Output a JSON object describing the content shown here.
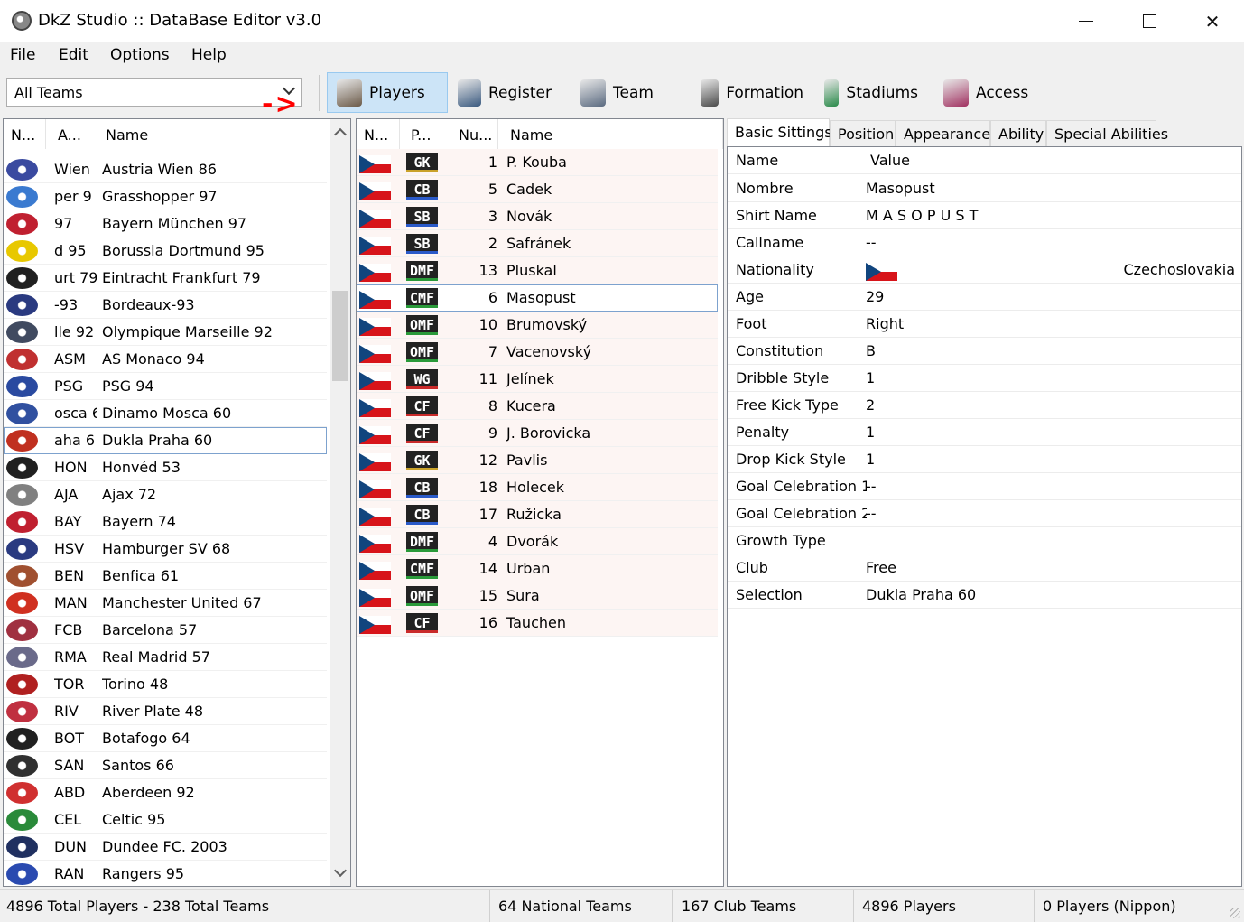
{
  "window": {
    "title": "DkZ Studio :: DataBase Editor v3.0"
  },
  "menu": [
    "File",
    "Edit",
    "Options",
    "Help"
  ],
  "toolbar": {
    "team_filter": "All Teams",
    "buttons": [
      {
        "label": "Players",
        "icon": "player-head-icon",
        "active": true
      },
      {
        "label": "Register",
        "icon": "register-players-icon",
        "active": false
      },
      {
        "label": "Team",
        "icon": "team-badge-icon",
        "active": false
      },
      {
        "label": "Formation",
        "icon": "formation-10-icon",
        "active": false
      },
      {
        "label": "Stadiums",
        "icon": "stadium-icon",
        "active": false
      },
      {
        "label": "Access",
        "icon": "access-database-icon",
        "active": false
      }
    ]
  },
  "teams_list": {
    "headers": [
      "N...",
      "A...",
      "Name"
    ],
    "selected_index": 10,
    "rows": [
      {
        "abbr": "Wien",
        "name": "Austria Wien 86",
        "color": "#3a4aa0"
      },
      {
        "abbr": "per 9",
        "name": "Grasshopper 97",
        "color": "#3a7ad0"
      },
      {
        "abbr": "97",
        "name": "Bayern München 97",
        "color": "#c02030"
      },
      {
        "abbr": "d 95",
        "name": "Borussia Dortmund 95",
        "color": "#e8c800"
      },
      {
        "abbr": "urt 79",
        "name": "Eintracht Frankfurt 79",
        "color": "#202020"
      },
      {
        "abbr": "-93",
        "name": "Bordeaux-93",
        "color": "#2a3a80"
      },
      {
        "abbr": "lle 92",
        "name": "Olympique Marseille 92",
        "color": "#404a60"
      },
      {
        "abbr": "ASM",
        "name": "AS Monaco 94",
        "color": "#c03030"
      },
      {
        "abbr": "PSG",
        "name": "PSG 94",
        "color": "#2a4aa0"
      },
      {
        "abbr": "osca 6",
        "name": "Dinamo Mosca 60",
        "color": "#3050a0"
      },
      {
        "abbr": "aha 6",
        "name": "Dukla Praha 60",
        "color": "#c03020"
      },
      {
        "abbr": "HON",
        "name": "Honvéd 53",
        "color": "#202020"
      },
      {
        "abbr": "AJA",
        "name": "Ajax 72",
        "color": "#808080"
      },
      {
        "abbr": "BAY",
        "name": "Bayern 74",
        "color": "#c02030"
      },
      {
        "abbr": "HSV",
        "name": "Hamburger SV 68",
        "color": "#2a3a80"
      },
      {
        "abbr": "BEN",
        "name": "Benfica 61",
        "color": "#a05030"
      },
      {
        "abbr": "MAN",
        "name": "Manchester United 67",
        "color": "#d03020"
      },
      {
        "abbr": "FCB",
        "name": "Barcelona 57",
        "color": "#a03040"
      },
      {
        "abbr": "RMA",
        "name": "Real Madrid 57",
        "color": "#6a6a8a"
      },
      {
        "abbr": "TOR",
        "name": "Torino 48",
        "color": "#b02020"
      },
      {
        "abbr": "RIV",
        "name": "River Plate 48",
        "color": "#c03040"
      },
      {
        "abbr": "BOT",
        "name": "Botafogo 64",
        "color": "#202020"
      },
      {
        "abbr": "SAN",
        "name": "Santos 66",
        "color": "#303030"
      },
      {
        "abbr": "ABD",
        "name": "Aberdeen 92",
        "color": "#d03030"
      },
      {
        "abbr": "CEL",
        "name": "Celtic 95",
        "color": "#2a8a3a"
      },
      {
        "abbr": "DUN",
        "name": "Dundee FC. 2003",
        "color": "#203060"
      },
      {
        "abbr": "RAN",
        "name": "Rangers 95",
        "color": "#2a4ab0"
      }
    ]
  },
  "arrow_annotation": "->",
  "players_list": {
    "headers": [
      "N...",
      "P...",
      "Nu...",
      "Name"
    ],
    "selected_index": 5,
    "rows": [
      {
        "pos": "GK",
        "num": "1",
        "name": "P. Kouba",
        "kind": "gk"
      },
      {
        "pos": "CB",
        "num": "5",
        "name": "Cadek",
        "kind": "df"
      },
      {
        "pos": "SB",
        "num": "3",
        "name": "Novák",
        "kind": "df"
      },
      {
        "pos": "SB",
        "num": "2",
        "name": "Safránek",
        "kind": "df"
      },
      {
        "pos": "DMF",
        "num": "13",
        "name": "Pluskal",
        "kind": "md"
      },
      {
        "pos": "CMF",
        "num": "6",
        "name": "Masopust",
        "kind": "md"
      },
      {
        "pos": "OMF",
        "num": "10",
        "name": "Brumovský",
        "kind": "md"
      },
      {
        "pos": "OMF",
        "num": "7",
        "name": "Vacenovský",
        "kind": "md"
      },
      {
        "pos": "WG",
        "num": "11",
        "name": "Jelínek",
        "kind": "fw"
      },
      {
        "pos": "CF",
        "num": "8",
        "name": "Kucera",
        "kind": "fw"
      },
      {
        "pos": "CF",
        "num": "9",
        "name": "J. Borovicka",
        "kind": "fw"
      },
      {
        "pos": "GK",
        "num": "12",
        "name": "Pavlis",
        "kind": "gk"
      },
      {
        "pos": "CB",
        "num": "18",
        "name": "Holecek",
        "kind": "df"
      },
      {
        "pos": "CB",
        "num": "17",
        "name": "Ružicka",
        "kind": "df"
      },
      {
        "pos": "DMF",
        "num": "4",
        "name": "Dvorák",
        "kind": "md"
      },
      {
        "pos": "CMF",
        "num": "14",
        "name": "Urban",
        "kind": "md"
      },
      {
        "pos": "OMF",
        "num": "15",
        "name": "Sura",
        "kind": "md"
      },
      {
        "pos": "CF",
        "num": "16",
        "name": "Tauchen",
        "kind": "fw"
      }
    ]
  },
  "detail_tabs": [
    "Basic Sittings",
    "Position",
    "Appearance",
    "Ability",
    "Special Abilities"
  ],
  "active_tab": 0,
  "details": {
    "headers": [
      "Name",
      "Value"
    ],
    "rows": [
      {
        "key": "Nombre",
        "value": "Masopust"
      },
      {
        "key": "Shirt Name",
        "value": "M A S O P U S T"
      },
      {
        "key": "Callname",
        "value": "--"
      },
      {
        "key": "Nationality",
        "value": "Czechoslovakia",
        "flag": true
      },
      {
        "key": "Age",
        "value": "29"
      },
      {
        "key": "Foot",
        "value": "Right"
      },
      {
        "key": "Constitution",
        "value": "B"
      },
      {
        "key": "Dribble Style",
        "value": "1"
      },
      {
        "key": "Free Kick Type",
        "value": "2"
      },
      {
        "key": "Penalty",
        "value": "1"
      },
      {
        "key": "Drop Kick Style",
        "value": "1"
      },
      {
        "key": "Goal Celebration 1",
        "value": "--"
      },
      {
        "key": "Goal Celebration 2",
        "value": "--"
      },
      {
        "key": "Growth Type",
        "value": ""
      },
      {
        "key": "Club",
        "value": "Free"
      },
      {
        "key": "Selection",
        "value": "Dukla Praha 60"
      }
    ]
  },
  "status": {
    "totals": "4896 Total Players  -  238 Total Teams",
    "national": "64 National Teams",
    "club": "167 Club Teams",
    "players": "4896 Players",
    "nippon": "0 Players (Nippon)"
  }
}
